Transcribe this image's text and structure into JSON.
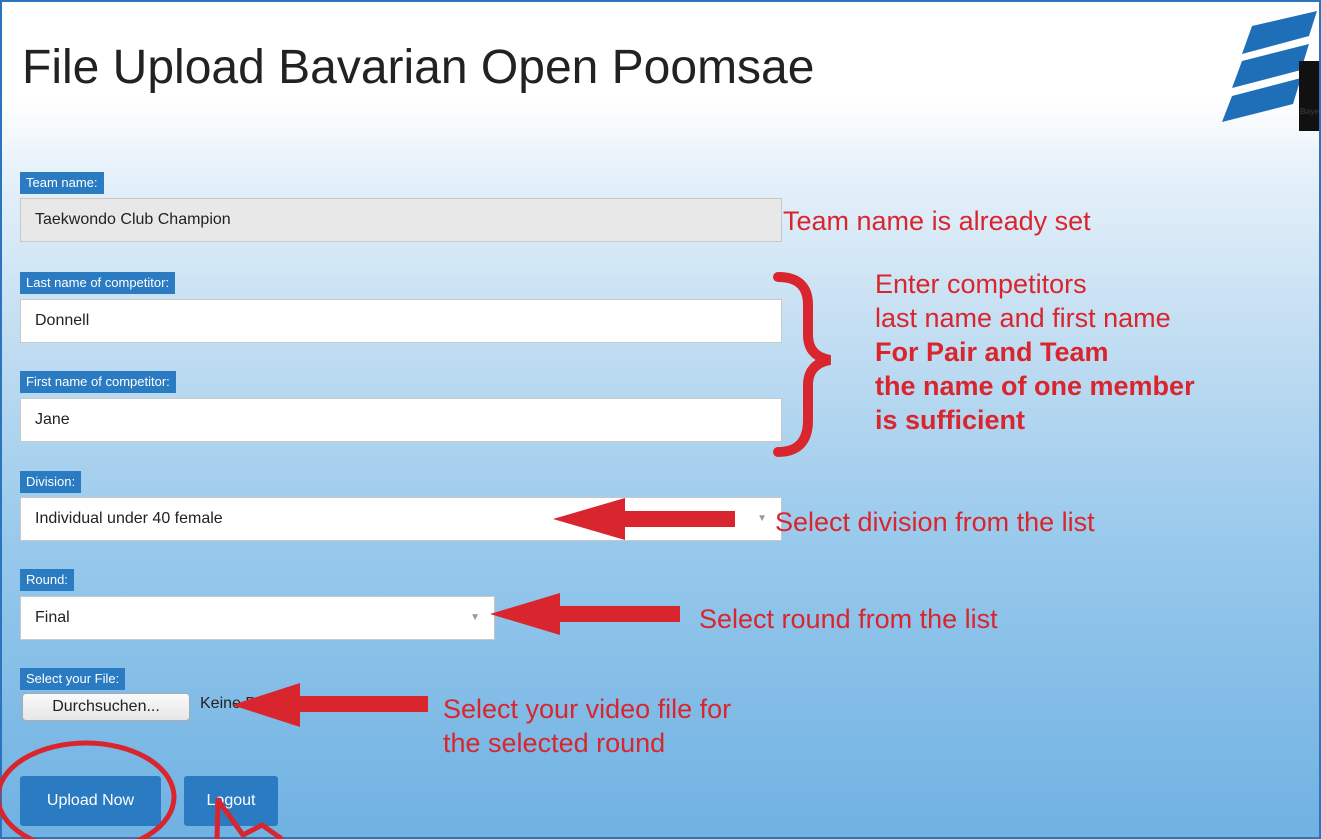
{
  "header": {
    "title": "File Upload Bavarian Open Poomsae",
    "logo_text": "Bayer"
  },
  "form": {
    "team_name": {
      "label": "Team name:",
      "value": "Taekwondo Club Champion"
    },
    "last_name": {
      "label": "Last name of competitor:",
      "value": "Donnell"
    },
    "first_name": {
      "label": "First name of competitor:",
      "value": "Jane"
    },
    "division": {
      "label": "Division:",
      "value": "Individual under 40 female"
    },
    "round": {
      "label": "Round:",
      "value": "Final"
    },
    "file": {
      "label": "Select your File:",
      "button": "Durchsuchen...",
      "status": "Keine Datei ausgewählt."
    },
    "upload_button": "Upload Now",
    "logout_button": "Logout"
  },
  "annotations": {
    "team": "Team name is already set",
    "names_line1": "Enter competitors",
    "names_line2": "last name and first name",
    "names_line3": "For Pair and Team",
    "names_line4": "the name of one member",
    "names_line5": "is sufficient",
    "division": "Select division from the list",
    "round": "Select round from the list",
    "file_line1": "Select your video file for",
    "file_line2": "the selected round"
  },
  "colors": {
    "accent": "#2a7bc1",
    "annotation": "#d9252d"
  }
}
